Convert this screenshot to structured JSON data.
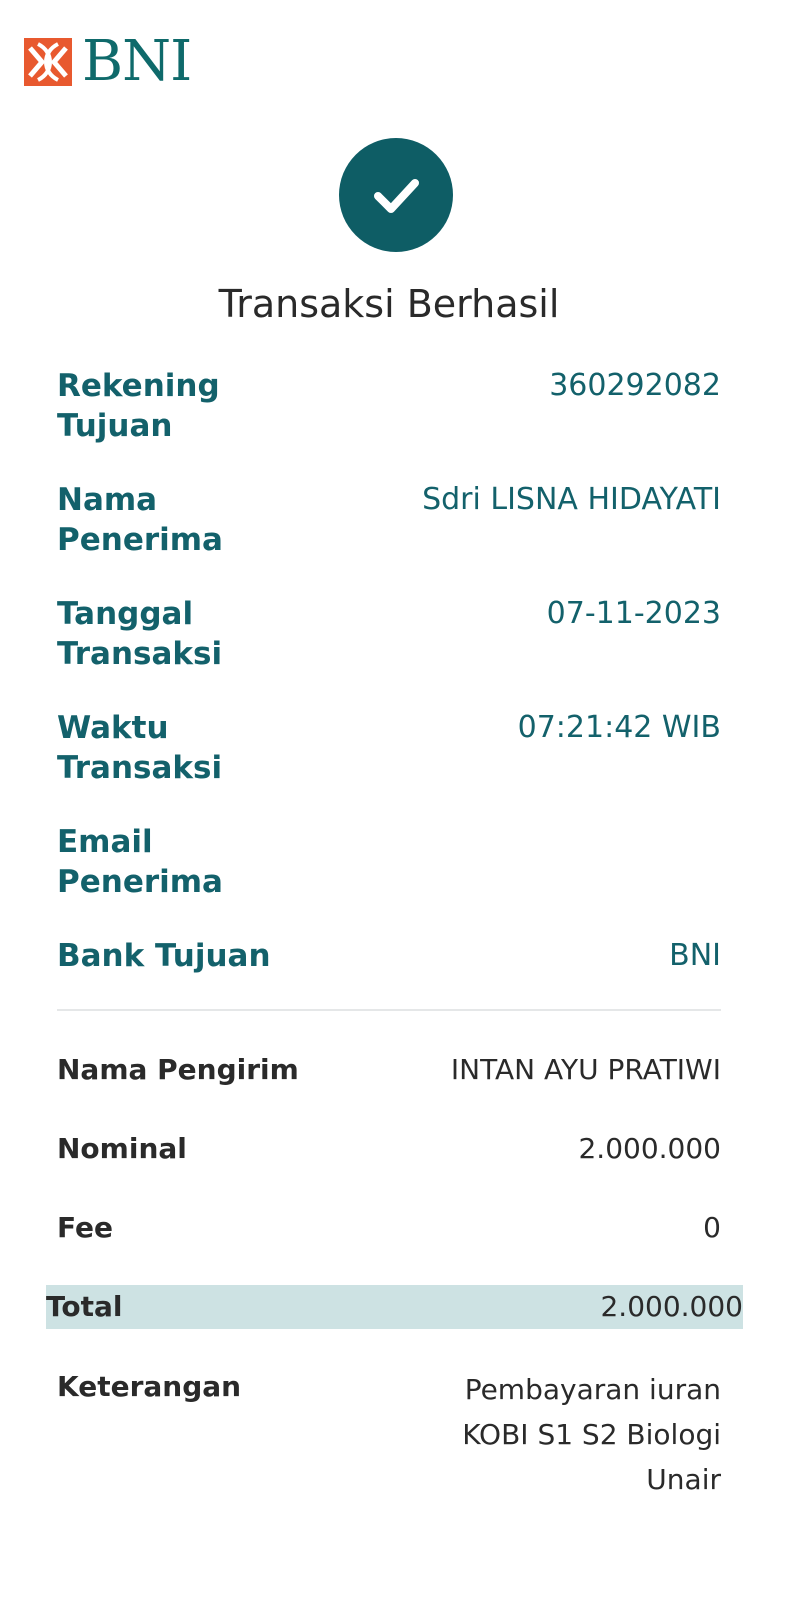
{
  "brand": {
    "name": "BNI",
    "orange": "#e8592f",
    "teal": "#0f6a6b"
  },
  "status": {
    "icon": "check-icon",
    "title": "Transaksi Berhasil"
  },
  "recipient": {
    "account_label_1": "Rekening",
    "account_label_2": "Tujuan",
    "account_value": "360292082",
    "name_label_1": "Nama",
    "name_label_2": "Penerima",
    "name_value": "Sdri LISNA HIDAYATI",
    "date_label_1": "Tanggal",
    "date_label_2": "Transaksi",
    "date_value": "07-11-2023",
    "time_label_1": "Waktu",
    "time_label_2": "Transaksi",
    "time_value": "07:21:42 WIB",
    "email_label_1": "Email",
    "email_label_2": "Penerima",
    "email_value": "",
    "bank_label": "Bank Tujuan",
    "bank_value": "BNI"
  },
  "details": {
    "sender_label": "Nama Pengirim",
    "sender_value": "INTAN AYU PRATIWI",
    "nominal_label": "Nominal",
    "nominal_value": "2.000.000",
    "fee_label": "Fee",
    "fee_value": "0",
    "total_label": "Total",
    "total_value": "2.000.000",
    "note_label": "Keterangan",
    "note_line_1": "Pembayaran iuran",
    "note_line_2": "KOBI S1 S2 Biologi",
    "note_line_3": "Unair"
  }
}
